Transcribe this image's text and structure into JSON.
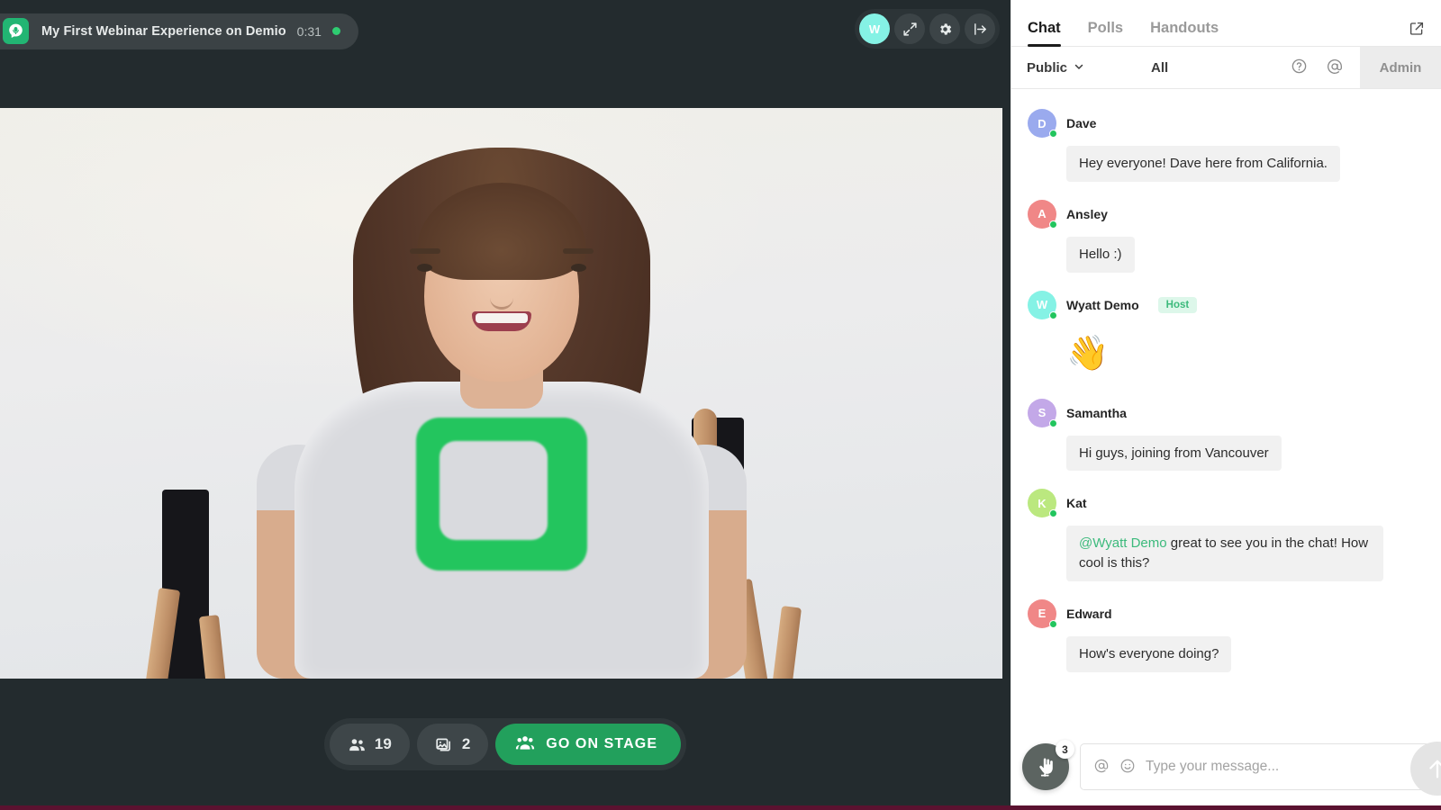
{
  "window": {
    "logo_icon": "demio-logo-icon",
    "title": "My First Webinar Experience on Demio",
    "elapsed": "0:31",
    "live_indicator": "live-dot"
  },
  "top_actions": {
    "avatar_initial": "W",
    "avatar_color": "#85f2e5",
    "buttons": [
      {
        "name": "expand-button",
        "icon": "expand-arrows-icon"
      },
      {
        "name": "settings-button",
        "icon": "gear-icon"
      },
      {
        "name": "exit-button",
        "icon": "exit-arrow-icon"
      }
    ]
  },
  "stage": {
    "attendees_count": "19",
    "attendees_icon": "people-icon",
    "materials_count": "2",
    "materials_icon": "slides-icon",
    "go_on_stage_label": "GO ON STAGE",
    "go_on_stage_icon": "group-icon",
    "go_on_stage_color": "#22a05c"
  },
  "panel": {
    "tabs": [
      {
        "label": "Chat",
        "active": true
      },
      {
        "label": "Polls",
        "active": false
      },
      {
        "label": "Handouts",
        "active": false
      }
    ],
    "popout_icon": "external-link-icon",
    "filter": {
      "visibility": "Public",
      "visibility_caret": "chevron-down-icon",
      "scope": "All",
      "help_icon": "question-circle-icon",
      "mention_icon": "at-icon",
      "admin_label": "Admin"
    },
    "messages": [
      {
        "author": "Dave",
        "initial": "D",
        "color": "#9aaaee",
        "online": true,
        "badge": null,
        "text": "Hey everyone! Dave here from California.",
        "emoji_only": false,
        "mention": null
      },
      {
        "author": "Ansley",
        "initial": "A",
        "color": "#f08787",
        "online": true,
        "badge": null,
        "text": "Hello :)",
        "emoji_only": false,
        "mention": null
      },
      {
        "author": "Wyatt Demo",
        "initial": "W",
        "color": "#85f2e5",
        "online": true,
        "badge": "Host",
        "text": "👋",
        "emoji_only": true,
        "mention": null
      },
      {
        "author": "Samantha",
        "initial": "S",
        "color": "#c3a8e8",
        "online": true,
        "badge": null,
        "text": "Hi guys, joining from Vancouver",
        "emoji_only": false,
        "mention": null
      },
      {
        "author": "Kat",
        "initial": "K",
        "color": "#bbe87f",
        "online": true,
        "badge": null,
        "text": " great to see you in the chat! How cool is this?",
        "emoji_only": false,
        "mention": "@Wyatt Demo"
      },
      {
        "author": "Edward",
        "initial": "E",
        "color": "#f08787",
        "online": true,
        "badge": null,
        "text": "How's everyone doing?",
        "emoji_only": false,
        "mention": null
      }
    ],
    "composer": {
      "raise_hand_icon": "raise-hand-icon",
      "raise_hand_badge": "3",
      "mention_icon": "at-icon",
      "emoji_icon": "smiley-icon",
      "placeholder": "Type your message...",
      "value": "",
      "send_icon": "arrow-up-icon"
    }
  },
  "colors": {
    "app_background": "#232b2e",
    "accent_green": "#22a05c",
    "mention_green": "#3cba7c",
    "host_badge_bg": "#ddf7ea"
  }
}
